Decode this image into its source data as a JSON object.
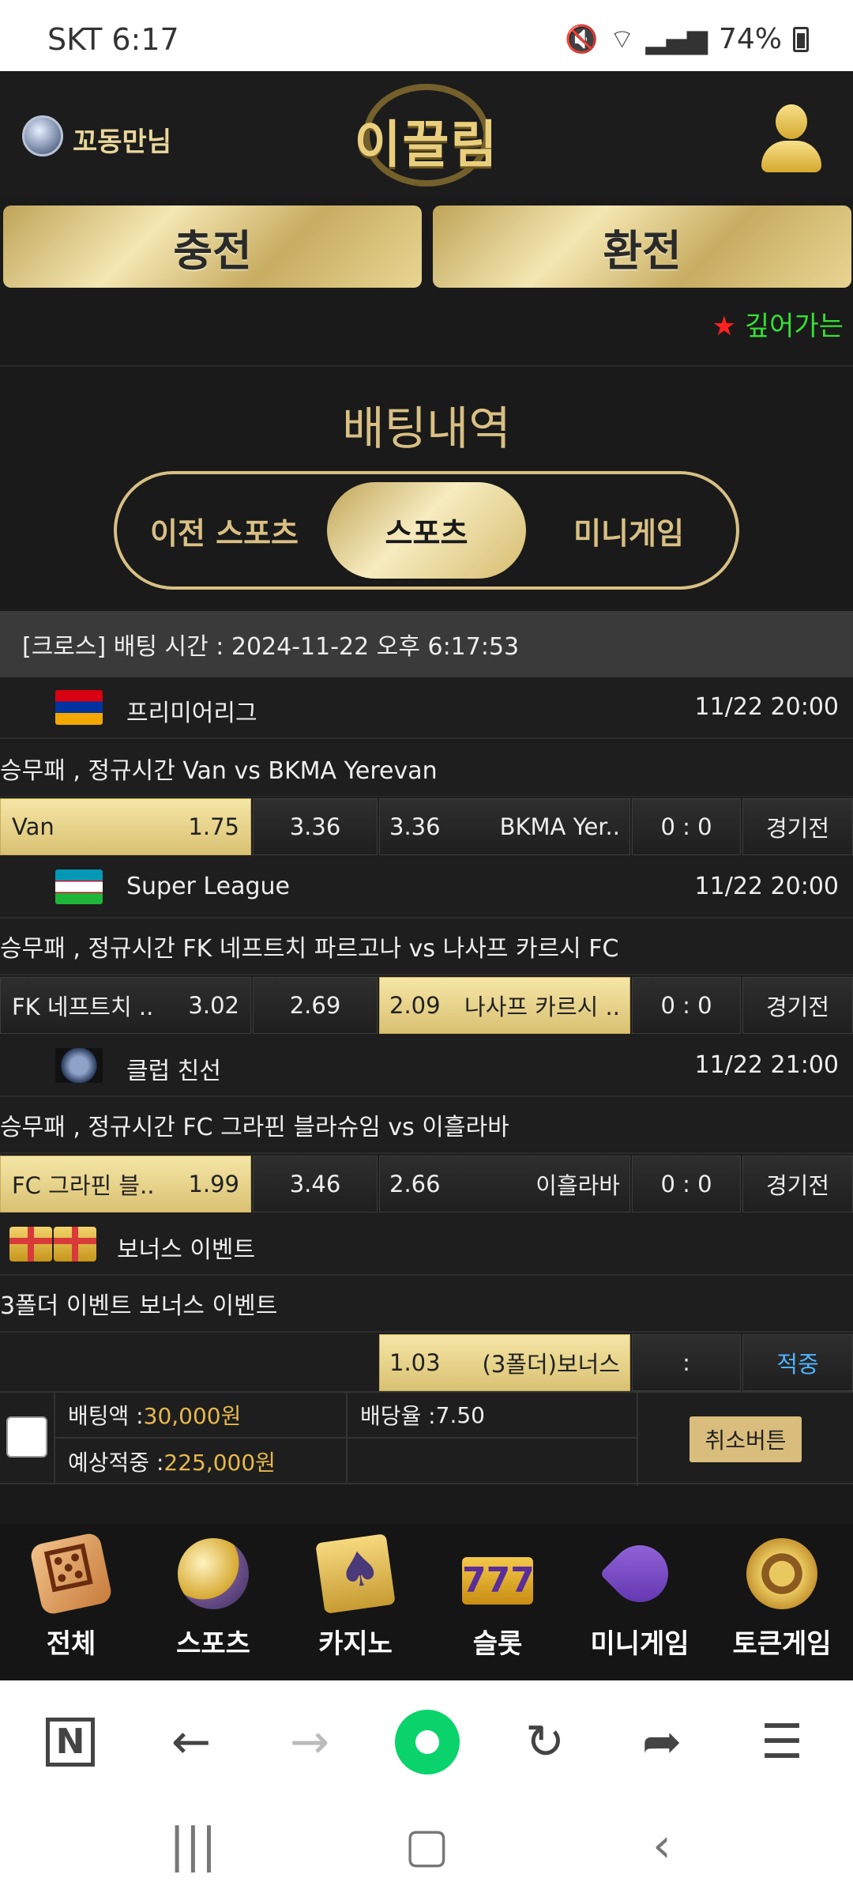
{
  "status_bar": {
    "time": "SKT 6:17",
    "battery": "74%",
    "icons": [
      "mute-icon",
      "wifi-icon",
      "signal-icon",
      "battery-icon"
    ]
  },
  "header": {
    "nickname": "꼬동만님",
    "logo_text": "이끌림",
    "rank_icon": "rank-badge-icon",
    "user_icon": "user-icon"
  },
  "actions": {
    "charge": "충전",
    "exchange": "환전"
  },
  "notice": {
    "star": "★",
    "text": "깊어가는"
  },
  "page_title": "배팅내역",
  "tabs": [
    {
      "label": "이전 스포츠",
      "active": false
    },
    {
      "label": "스포츠",
      "active": true
    },
    {
      "label": "미니게임",
      "active": false
    }
  ],
  "bet": {
    "header": "[크로스] 배팅 시간 : 2024-11-22 오후 6:17:53",
    "matches": [
      {
        "league": "프리미어리그",
        "date": "11/22 20:00",
        "flag": "armenia-flag",
        "desc": "승무패 , 정규시간 Van  vs  BKMA Yerevan",
        "home": "Van",
        "home_odds": "1.75",
        "draw": "3.36",
        "away_odds": "3.36",
        "away": "BKMA Yer..",
        "score": "0 : 0",
        "status": "경기전",
        "selected": "home"
      },
      {
        "league": "Super League",
        "date": "11/22 20:00",
        "flag": "uzbekistan-flag",
        "desc": "승무패 , 정규시간 FK 네프트치 파르고나  vs  나사프 카르시 FC",
        "home": "FK 네프트치 ..",
        "home_odds": "3.02",
        "draw": "2.69",
        "away_odds": "2.09",
        "away": "나사프 카르시 ..",
        "score": "0 : 0",
        "status": "경기전",
        "selected": "away"
      },
      {
        "league": "클럽 친선",
        "date": "11/22 21:00",
        "flag": "world-flag",
        "desc": "승무패 , 정규시간 FC 그라핀 블라슈임  vs  이흘라바",
        "home": "FC 그라핀 블..",
        "home_odds": "1.99",
        "draw": "3.46",
        "away_odds": "2.66",
        "away": "이흘라바",
        "score": "0 : 0",
        "status": "경기전",
        "selected": "home"
      }
    ],
    "bonus": {
      "name": "보너스 이벤트",
      "desc": "3폴더 이벤트 보너스 이벤트",
      "odds": "1.03",
      "label": "(3폴더)보너스",
      "score": ":",
      "status": "적중"
    },
    "summary": {
      "amount_label": "배팅액 : ",
      "amount": "30,000원",
      "rate_label": "배당율 : ",
      "rate": "7.50",
      "expected_label": "예상적중 : ",
      "expected": "225,000원",
      "cancel": "취소버튼"
    }
  },
  "categories": [
    {
      "label": "전체",
      "icon": "dice-icon"
    },
    {
      "label": "스포츠",
      "icon": "soccer-ball-icon"
    },
    {
      "label": "카지노",
      "icon": "cards-icon"
    },
    {
      "label": "슬롯",
      "icon": "slot-777-icon",
      "glyph": "777"
    },
    {
      "label": "미니게임",
      "icon": "rocket-icon"
    },
    {
      "label": "토큰게임",
      "icon": "roulette-icon"
    }
  ],
  "browser": {
    "n_icon": "N",
    "back": "←",
    "forward": "→",
    "reload": "↻",
    "share": "➦",
    "menu": "☰"
  },
  "system_nav": {
    "recents": "|||",
    "home": "▢",
    "back": "‹"
  },
  "colors": {
    "gold": "#d8c084",
    "accent_green": "#36e034",
    "hit_blue": "#4fb3ff",
    "amount": "#e6b84c"
  }
}
